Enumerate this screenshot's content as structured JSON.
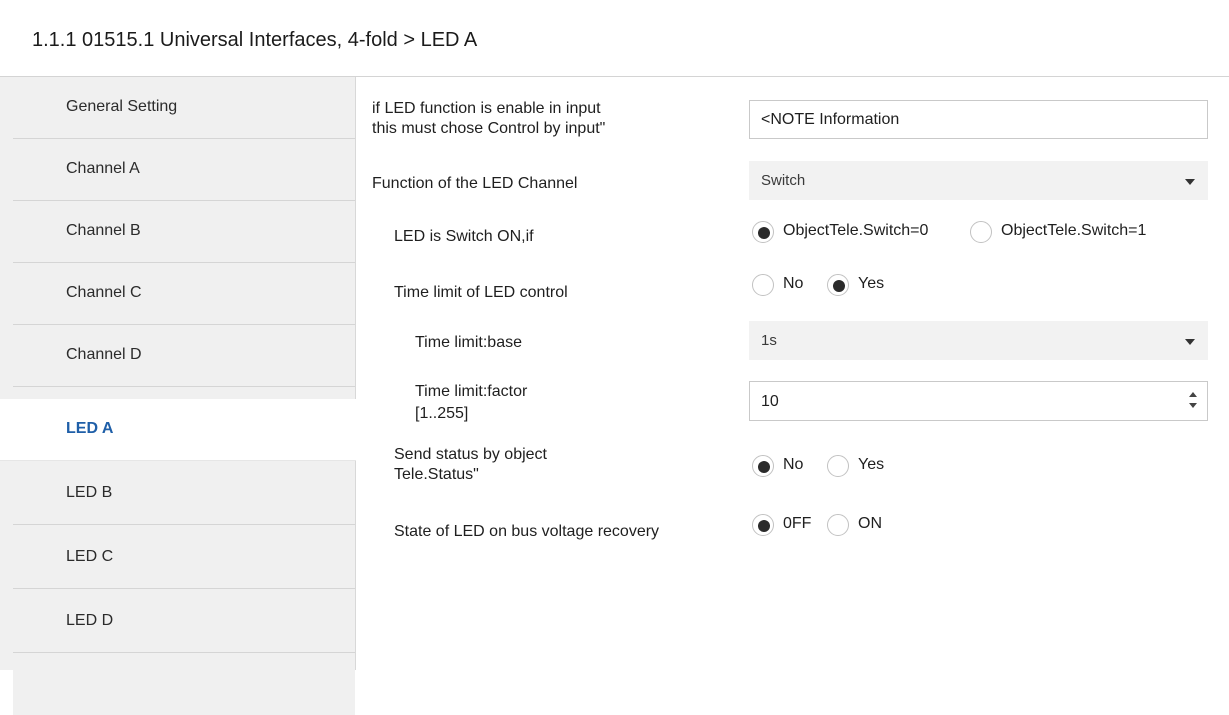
{
  "window": {
    "title": "1.1.1 01515.1 Universal Interfaces, 4-fold > LED A"
  },
  "sidebar": {
    "items": [
      {
        "label": "General Setting"
      },
      {
        "label": "Channel A"
      },
      {
        "label": "Channel B"
      },
      {
        "label": "Channel C"
      },
      {
        "label": "Channel D"
      },
      {
        "label": "LED A",
        "active": true
      },
      {
        "label": "LED B"
      },
      {
        "label": "LED C"
      },
      {
        "label": "LED D"
      }
    ],
    "active_color": "#1f5fa8"
  },
  "form": {
    "note": {
      "label_line1": "if LED function is enable in input",
      "label_line2": "this must chose Control by input\"",
      "value": "<NOTE Information"
    },
    "function": {
      "label": "Function of the LED Channel",
      "value": "Switch"
    },
    "switch_on_if": {
      "label": "LED is Switch ON,if",
      "options": [
        "ObjectTele.Switch=0",
        "ObjectTele.Switch=1"
      ],
      "selected": "ObjectTele.Switch=0"
    },
    "time_limit": {
      "label": "Time limit of LED control",
      "options": [
        "No",
        "Yes"
      ],
      "selected": "Yes"
    },
    "time_base": {
      "label": "Time limit:base",
      "value": "1s"
    },
    "time_factor": {
      "label_line1": "Time limit:factor",
      "label_line2": "[1..255]",
      "value": "10"
    },
    "send_status": {
      "label_line1": "Send status by object",
      "label_line2": "Tele.Status\"",
      "options": [
        "No",
        "Yes"
      ],
      "selected": "No"
    },
    "bus_recovery": {
      "label": "State of LED on bus voltage recovery",
      "options": [
        "0FF",
        "ON"
      ],
      "selected": "0FF"
    }
  }
}
